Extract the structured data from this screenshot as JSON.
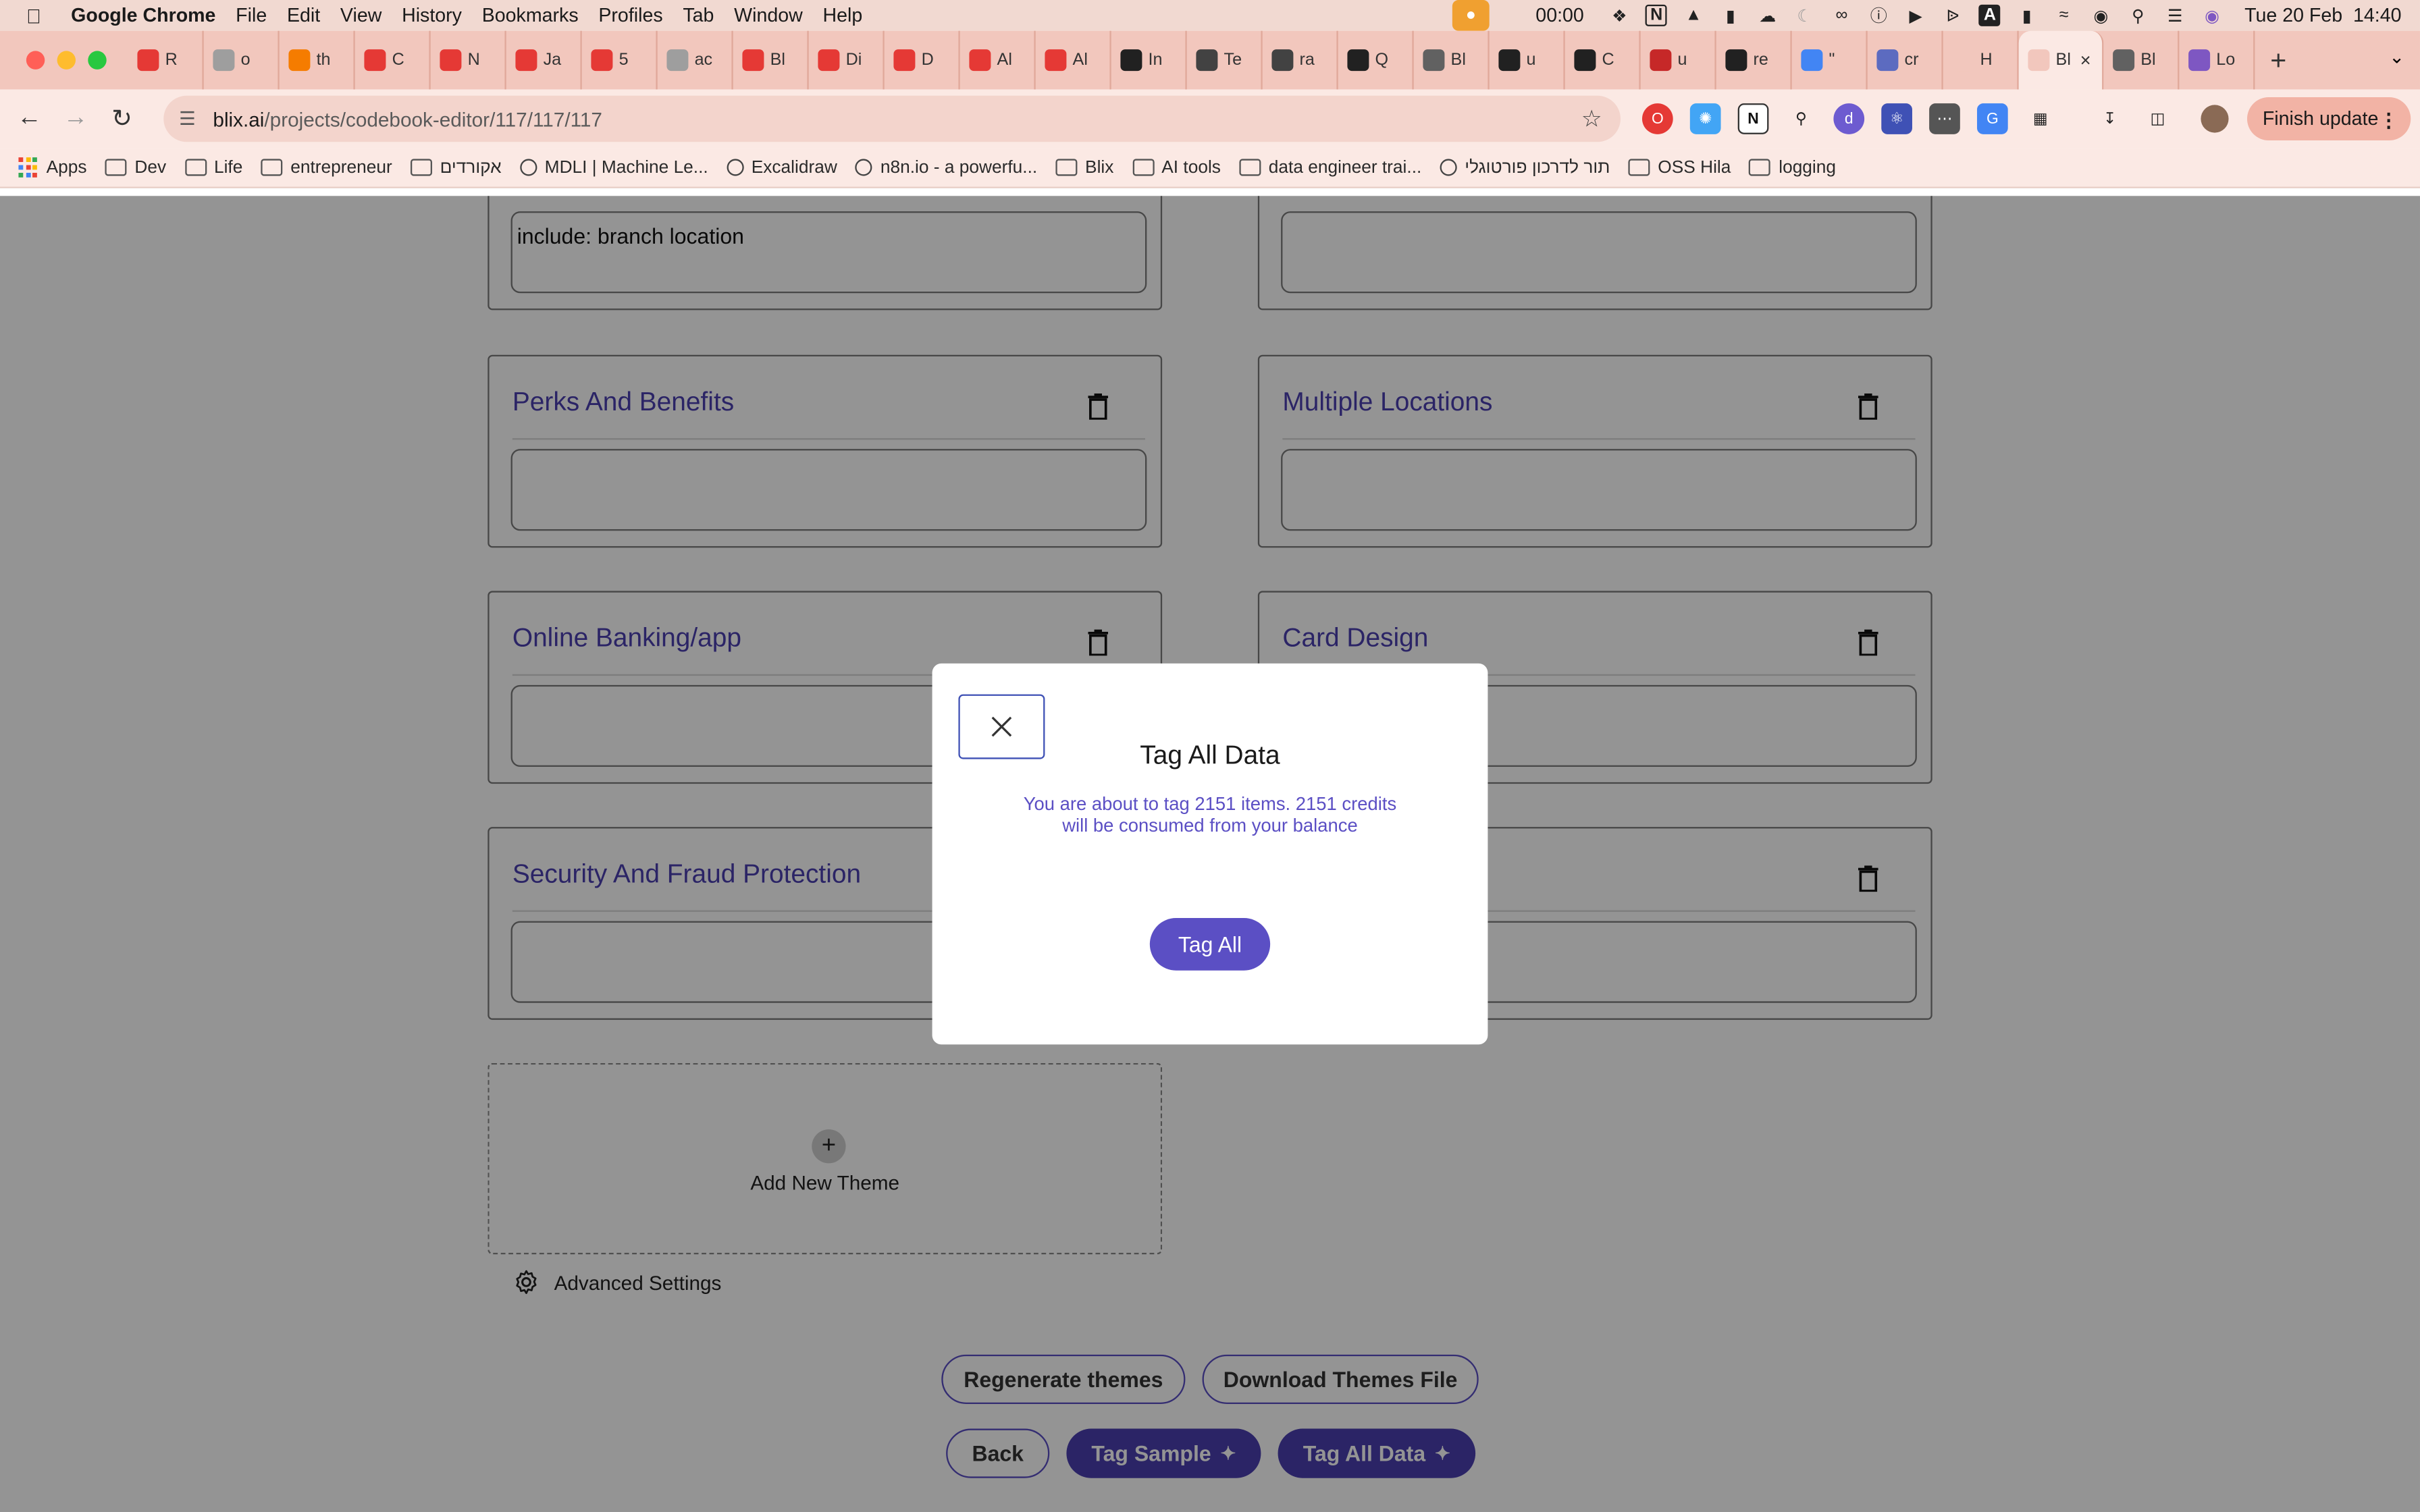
{
  "menubar": {
    "app_name": "Google Chrome",
    "items": [
      "File",
      "Edit",
      "View",
      "History",
      "Bookmarks",
      "Profiles",
      "Tab",
      "Window",
      "Help"
    ],
    "timer": "00:00",
    "date_time": "Tue 20 Feb  14:40"
  },
  "tabs": [
    {
      "label": "R",
      "color": "#e53935"
    },
    {
      "label": "o",
      "color": "#9e9e9e"
    },
    {
      "label": "th",
      "color": "#f57c00"
    },
    {
      "label": "C",
      "color": "#e53935"
    },
    {
      "label": "N",
      "color": "#e53935"
    },
    {
      "label": "Ja",
      "color": "#e53935"
    },
    {
      "label": "5",
      "color": "#e53935"
    },
    {
      "label": "ac",
      "color": "#9e9e9e"
    },
    {
      "label": "Bl",
      "color": "#e53935"
    },
    {
      "label": "Di",
      "color": "#e53935"
    },
    {
      "label": "D",
      "color": "#e53935"
    },
    {
      "label": "Al",
      "color": "#e53935"
    },
    {
      "label": "Al",
      "color": "#e53935"
    },
    {
      "label": "In",
      "color": "#212121"
    },
    {
      "label": "Te",
      "color": "#424242"
    },
    {
      "label": "ra",
      "color": "#424242"
    },
    {
      "label": "Q",
      "color": "#212121"
    },
    {
      "label": "Bl",
      "color": "#616161"
    },
    {
      "label": "u",
      "color": "#212121"
    },
    {
      "label": "C",
      "color": "#212121"
    },
    {
      "label": "u",
      "color": "#c62828"
    },
    {
      "label": "re",
      "color": "#212121"
    },
    {
      "label": "\"",
      "color": "#4285f4"
    },
    {
      "label": "cr",
      "color": "#5c6bc0"
    },
    {
      "label": "H",
      "color": "#f2c7bd"
    },
    {
      "label": "Bl",
      "color": "#f2c7bd",
      "active": true
    },
    {
      "label": "Bl",
      "color": "#616161"
    },
    {
      "label": "Lo",
      "color": "#7e57c2"
    }
  ],
  "toolbar": {
    "url_host": "blix.ai",
    "url_path": "/projects/codebook-editor/117/117/117",
    "finish_update_label": "Finish update"
  },
  "bookmarks": [
    {
      "label": "Apps",
      "type": "apps"
    },
    {
      "label": "Dev",
      "type": "folder"
    },
    {
      "label": "Life",
      "type": "folder"
    },
    {
      "label": "entrepreneur",
      "type": "folder"
    },
    {
      "label": "אקורדים",
      "type": "folder"
    },
    {
      "label": "MDLI | Machine Le...",
      "type": "site"
    },
    {
      "label": "Excalidraw",
      "type": "site"
    },
    {
      "label": "n8n.io - a powerfu...",
      "type": "site"
    },
    {
      "label": "Blix",
      "type": "folder"
    },
    {
      "label": "AI tools",
      "type": "folder"
    },
    {
      "label": "data engineer trai...",
      "type": "folder"
    },
    {
      "label": "תור לדרכון פורטוגלי",
      "type": "site"
    },
    {
      "label": "OSS Hila",
      "type": "folder"
    },
    {
      "label": "logging",
      "type": "folder"
    }
  ],
  "themes": {
    "top_left_value": "include: branch location",
    "cards": [
      {
        "title": "Perks And Benefits",
        "value": ""
      },
      {
        "title": "Multiple Locations",
        "value": ""
      },
      {
        "title": "Online Banking/app",
        "value": ""
      },
      {
        "title": "Card Design",
        "value": ""
      },
      {
        "title": "Security And Fraud Protection",
        "value": ""
      },
      {
        "title": "",
        "value": ""
      }
    ],
    "add_new_label": "Add New Theme",
    "advanced_settings_label": "Advanced Settings"
  },
  "actions": {
    "regenerate_label": "Regenerate themes",
    "download_label": "Download Themes File",
    "back_label": "Back",
    "tag_sample_label": "Tag Sample",
    "tag_all_data_label": "Tag All Data"
  },
  "modal": {
    "title": "Tag All Data",
    "message": "You are about to tag 2151 items. 2151 credits will be consumed from your balance",
    "confirm_label": "Tag All"
  }
}
